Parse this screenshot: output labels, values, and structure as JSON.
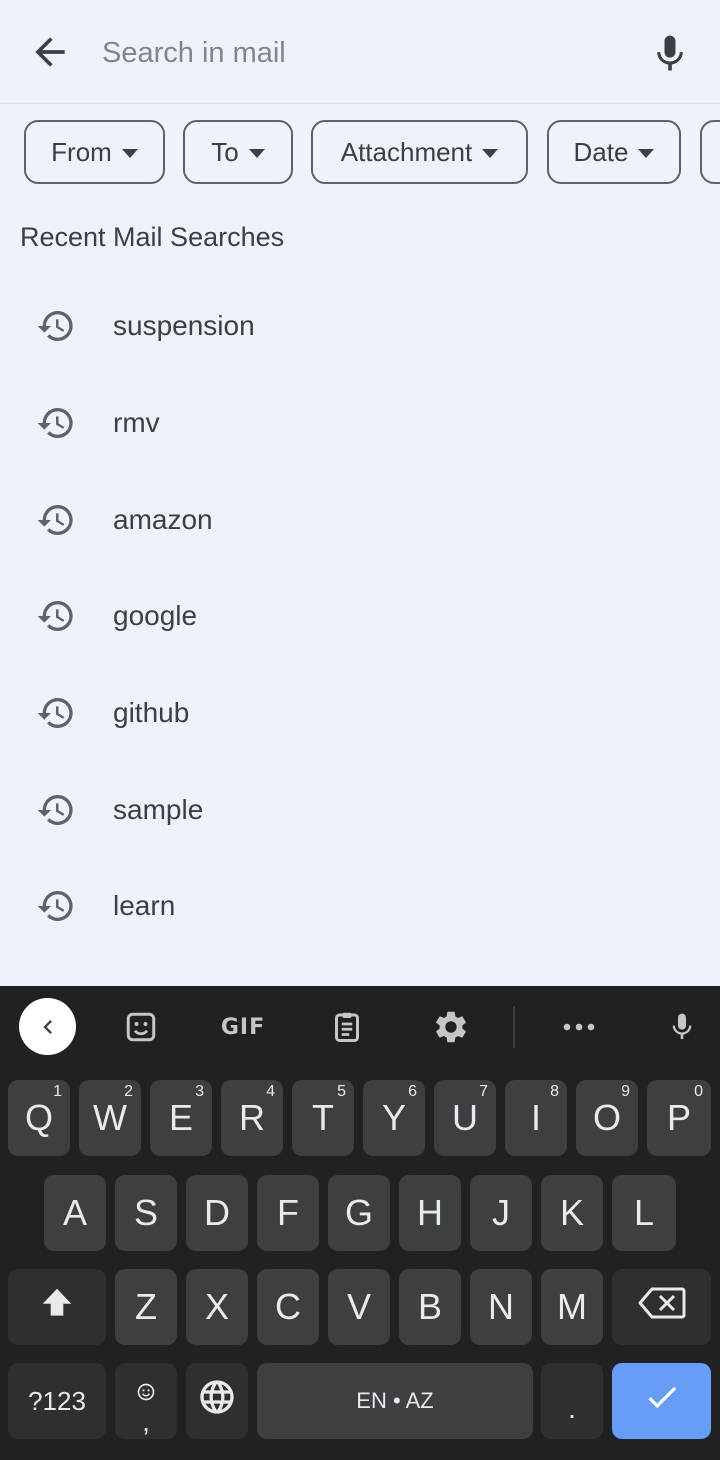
{
  "search": {
    "placeholder": "Search in mail",
    "value": ""
  },
  "chips": [
    {
      "label": "From"
    },
    {
      "label": "To"
    },
    {
      "label": "Attachment"
    },
    {
      "label": "Date"
    }
  ],
  "recent": {
    "title": "Recent Mail Searches",
    "items": [
      "suspension",
      "rmv",
      "amazon",
      "google",
      "github",
      "sample",
      "learn"
    ]
  },
  "keyboard": {
    "row1": [
      {
        "key": "Q",
        "hint": "1"
      },
      {
        "key": "W",
        "hint": "2"
      },
      {
        "key": "E",
        "hint": "3"
      },
      {
        "key": "R",
        "hint": "4"
      },
      {
        "key": "T",
        "hint": "5"
      },
      {
        "key": "Y",
        "hint": "6"
      },
      {
        "key": "U",
        "hint": "7"
      },
      {
        "key": "I",
        "hint": "8"
      },
      {
        "key": "O",
        "hint": "9"
      },
      {
        "key": "P",
        "hint": "0"
      }
    ],
    "row2": [
      "A",
      "S",
      "D",
      "F",
      "G",
      "H",
      "J",
      "K",
      "L"
    ],
    "row3": [
      "Z",
      "X",
      "C",
      "V",
      "B",
      "N",
      "M"
    ],
    "symbols_label": "?123",
    "comma_label": ",",
    "space_label": "EN • AZ",
    "period_label": ".",
    "toolbar": {
      "gif_label": "GIF"
    }
  },
  "colors": {
    "background": "#eef2fa",
    "keyboard_bg": "#202124",
    "key_bg": "#3c4043",
    "enter_key": "#669df6"
  }
}
